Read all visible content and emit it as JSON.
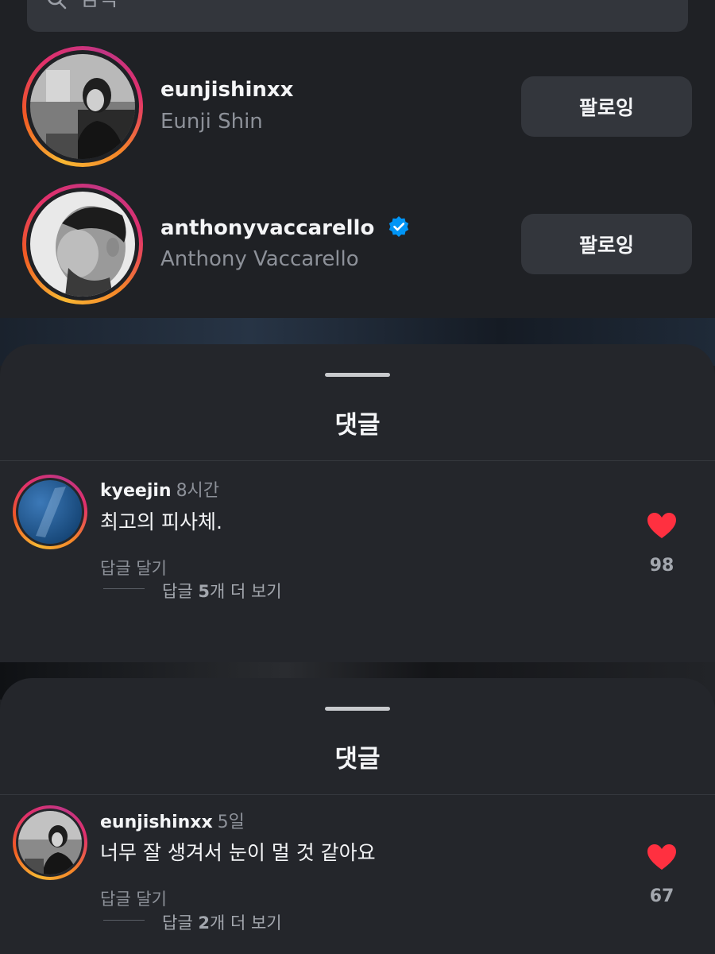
{
  "search": {
    "placeholder": "검색"
  },
  "following": [
    {
      "username": "eunjishinxx",
      "full_name": "Eunji Shin",
      "verified": false,
      "button_label": "팔로잉"
    },
    {
      "username": "anthonyvaccarello",
      "full_name": "Anthony Vaccarello",
      "verified": true,
      "button_label": "팔로잉"
    }
  ],
  "sheets": [
    {
      "title": "댓글",
      "comment": {
        "username": "kyeejin",
        "time": "8시간",
        "text": "최고의 피사체.",
        "reply_label": "답글 달기",
        "more_prefix": "답글 ",
        "more_count": "5",
        "more_suffix": "개 더 보기",
        "likes": "98"
      }
    },
    {
      "title": "댓글",
      "comment": {
        "username": "eunjishinxx",
        "time": "5일",
        "text": "너무 잘 생겨서 눈이 멀 것 같아요",
        "reply_label": "답글 달기",
        "more_prefix": "답글 ",
        "more_count": "2",
        "more_suffix": "개 더 보기",
        "likes": "67"
      }
    }
  ],
  "colors": {
    "like_red": "#ff3040",
    "verified_blue": "#0095f6",
    "story_ring": "#e1306c"
  },
  "icons": [
    "search-icon",
    "verified-badge-icon",
    "heart-icon"
  ]
}
